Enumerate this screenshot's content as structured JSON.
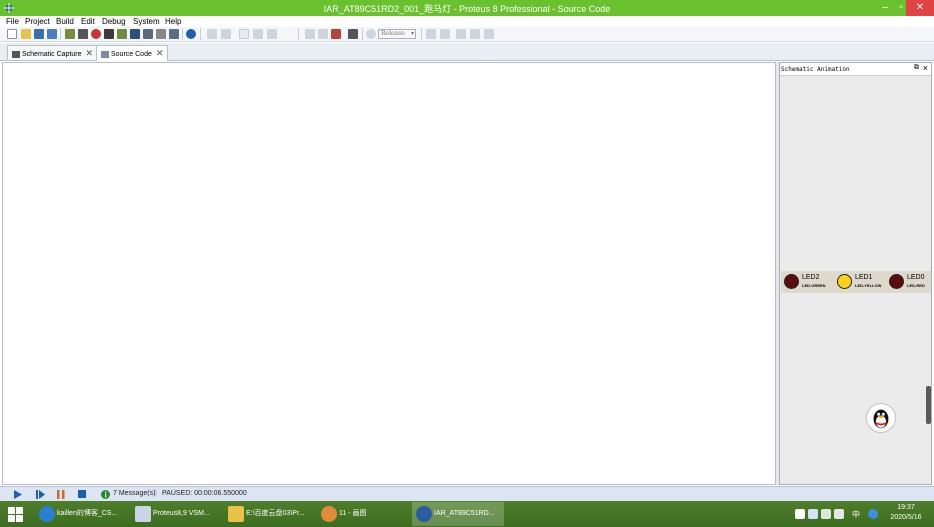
{
  "window": {
    "title": "IAR_AT89C51RD2_001_跑马灯 - Proteus 8 Professional - Source Code",
    "controls": {
      "minimize": "–",
      "maximize": "▫",
      "close": "✕"
    }
  },
  "menubar": [
    "File",
    "Project",
    "Build",
    "Edit",
    "Debug",
    "System",
    "Help"
  ],
  "toolbar": {
    "build_config": "Release"
  },
  "tabs": [
    {
      "label": "Schematic Capture",
      "active": false
    },
    {
      "label": "Source Code",
      "active": true
    }
  ],
  "right_panel": {
    "title": "Schematic Animation",
    "leds": [
      {
        "name": "LED2",
        "part": "LED-GREEN",
        "lit": false
      },
      {
        "name": "LED1",
        "part": "LED-YELLOW",
        "lit": true
      },
      {
        "name": "LED0",
        "part": "LED-RED",
        "lit": false
      }
    ]
  },
  "statusbar": {
    "messages": "7 Message(s)",
    "status": "PAUSED: 00:00:06.550000"
  },
  "taskbar": {
    "items": [
      {
        "label": "kaillen的博客_CS...",
        "active": false
      },
      {
        "label": "Proteus8,9 VSM...",
        "active": false
      },
      {
        "label": "E:\\百度云盘03\\Pr...",
        "active": false
      },
      {
        "label": "11 - 画图",
        "active": false
      },
      {
        "label": "IAR_AT89C51RD...",
        "active": true
      }
    ],
    "ime": "中",
    "time": "19:37",
    "date": "2020/5/16"
  },
  "colors": {
    "titlebar": "#6ac12e",
    "taskbar": "#3c6d20",
    "led_off": "#5a0d0d",
    "led_on": "#ffd21a"
  }
}
